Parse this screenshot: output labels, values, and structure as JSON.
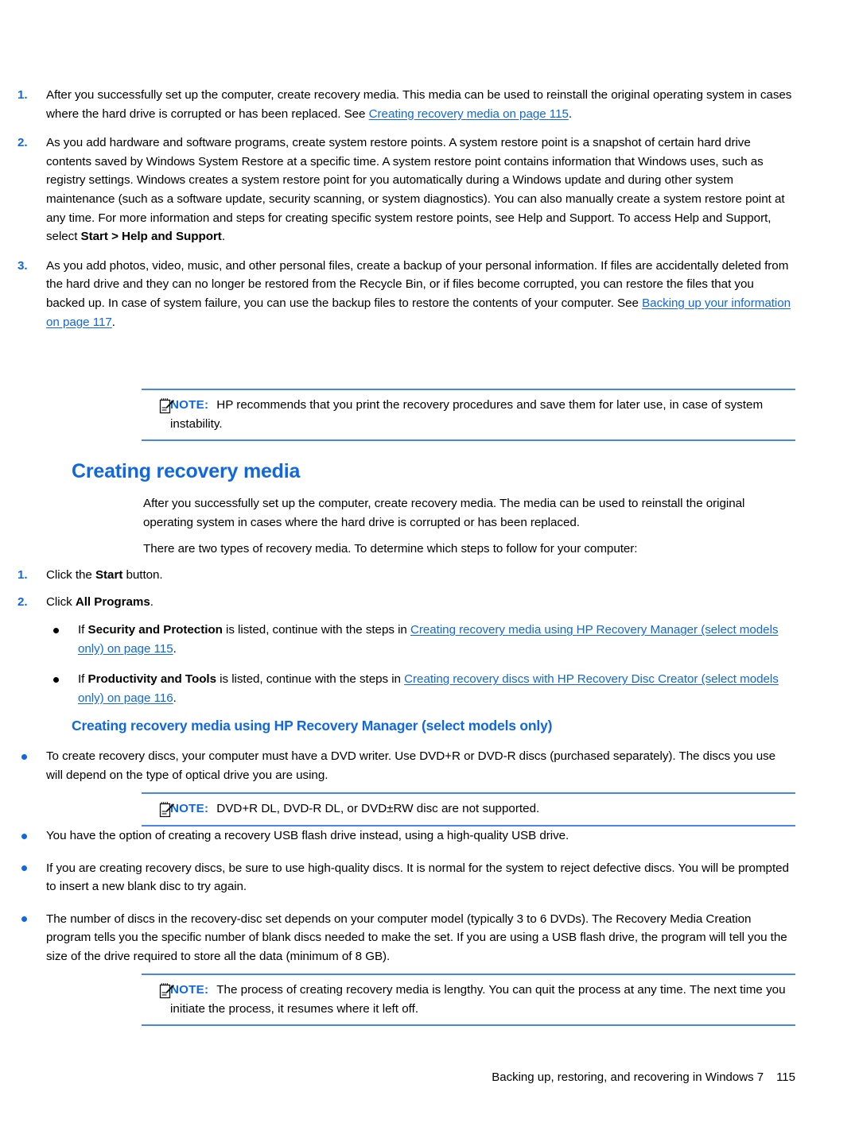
{
  "document": {
    "page_number": "115",
    "footer_text": "Backing up, restoring, and recovering in Windows 7"
  },
  "intro_steps": [
    {
      "number": "1.",
      "text_1": "After you successfully set up the computer, create recovery media. This media can be used to reinstall the original operating system in cases where the hard drive is corrupted or has been replaced. See ",
      "link": "Creating recovery media on page 115",
      "text_2": "."
    },
    {
      "number": "2.",
      "text_1": "As you add hardware and software programs, create system restore points. A system restore point is a snapshot of certain hard drive contents saved by Windows System Restore at a specific time. A system restore point contains information that Windows uses, such as registry settings. Windows creates a system restore point for you automatically during a Windows update and during other system maintenance (such as a software update, security scanning, or system diagnostics). You can also manually create a system restore point at any time. For more information and steps for creating specific system restore points, see Help and Support. To access Help and Support, select ",
      "bold": "Start > Help and Support",
      "text_2": "."
    },
    {
      "number": "3.",
      "text_1": "As you add photos, video, music, and other personal files, create a backup of your personal information. If files are accidentally deleted from the hard drive and they can no longer be restored from the Recycle Bin, or if files become corrupted, you can restore the files that you backed up. In case of system failure, you can use the backup files to restore the contents of your computer. See ",
      "link": "Backing up your information on page 117",
      "text_2": "."
    }
  ],
  "note_1": {
    "label": "NOTE:",
    "text": "HP recommends that you print the recovery procedures and save them for later use, in case of system instability."
  },
  "heading_1": "Creating recovery media",
  "paragraphs": [
    "After you successfully set up the computer, create recovery media. The media can be used to reinstall the original operating system in cases where the hard drive is corrupted or has been replaced.",
    "There are two types of recovery media. To determine which steps to follow for your computer:"
  ],
  "media_steps": [
    {
      "number": "1.",
      "text_1": "Click the ",
      "bold": "Start",
      "text_2": " button."
    },
    {
      "number": "2.",
      "text_1": "Click ",
      "bold": "All Programs",
      "text_2": "."
    }
  ],
  "media_bullets": [
    {
      "text_1": "If ",
      "bold": "Security and Protection",
      "text_2": " is listed, continue with the steps in ",
      "link": "Creating recovery media using HP Recovery Manager (select models only) on page 115",
      "text_3": "."
    },
    {
      "text_1": "If ",
      "bold": "Productivity and Tools",
      "text_2": " is listed, continue with the steps in ",
      "link": "Creating recovery discs with HP Recovery Disc Creator (select models only) on page 116",
      "text_3": "."
    }
  ],
  "heading_2": "Creating recovery media using HP Recovery Manager (select models only)",
  "manager_bullets_top": [
    "To create recovery discs, your computer must have a DVD writer. Use DVD+R or DVD-R discs (purchased separately). The discs you use will depend on the type of optical drive you are using."
  ],
  "note_2": {
    "label": "NOTE:",
    "text": "DVD+R DL, DVD-R DL, or DVD±RW disc are not supported."
  },
  "manager_bullets_bottom": [
    "You have the option of creating a recovery USB flash drive instead, using a high-quality USB drive.",
    "If you are creating recovery discs, be sure to use high-quality discs. It is normal for the system to reject defective discs. You will be prompted to insert a new blank disc to try again.",
    "The number of discs in the recovery-disc set depends on your computer model (typically 3 to 6 DVDs). The Recovery Media Creation program tells you the specific number of blank discs needed to make the set. If you are using a USB flash drive, the program will tell you the size of the drive required to store all the data (minimum of 8 GB)."
  ],
  "note_3": {
    "label": "NOTE:",
    "text": "The process of creating recovery media is lengthy. You can quit the process at any time. The next time you initiate the process, it resumes where it left off."
  },
  "colors": {
    "accent_blue": "#1068E0",
    "rule_blue": "#4a86E8",
    "text_black": "#000000"
  },
  "icons": {
    "note": "note-pencil-icon"
  }
}
